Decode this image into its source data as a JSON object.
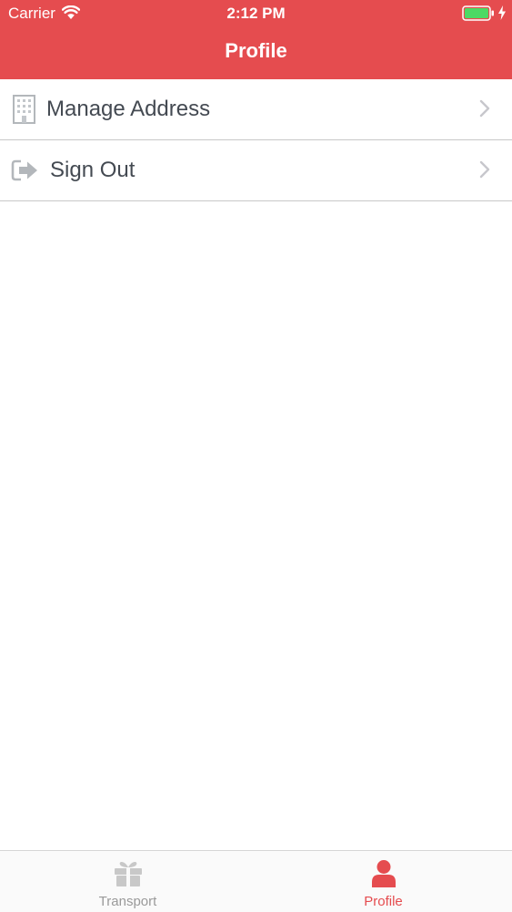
{
  "status_bar": {
    "carrier": "Carrier",
    "time": "2:12 PM",
    "icons": [
      "wifi-icon",
      "battery-icon",
      "charging-icon"
    ],
    "battery_level": 1.0
  },
  "header": {
    "title": "Profile",
    "background_color": "#e54c4f"
  },
  "menu": {
    "items": [
      {
        "label": "Manage Address",
        "icon": "building-icon"
      },
      {
        "label": "Sign Out",
        "icon": "sign-out-icon"
      }
    ]
  },
  "tab_bar": {
    "active_color": "#e54c4f",
    "inactive_color": "#9a9a9a",
    "tabs": [
      {
        "label": "Transport",
        "icon": "gift-icon",
        "active": false
      },
      {
        "label": "Profile",
        "icon": "user-icon",
        "active": true
      }
    ]
  }
}
